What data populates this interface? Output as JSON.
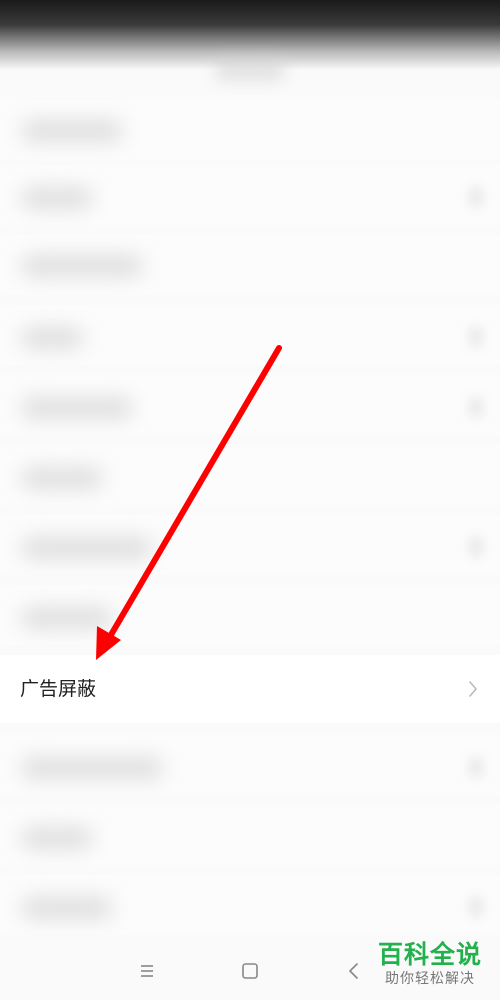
{
  "settings_list": {
    "highlighted_item": {
      "label": "广告屏蔽",
      "icon": "chevron-right-icon"
    }
  },
  "annotation": {
    "arrow_color": "#ff0000"
  },
  "navigation_bar": {
    "menu_icon": "menu-icon",
    "home_icon": "home-icon",
    "back_icon": "back-icon"
  },
  "watermark": {
    "main": "百科全说",
    "sub": "助你轻松解决",
    "color": "#22b14c"
  }
}
